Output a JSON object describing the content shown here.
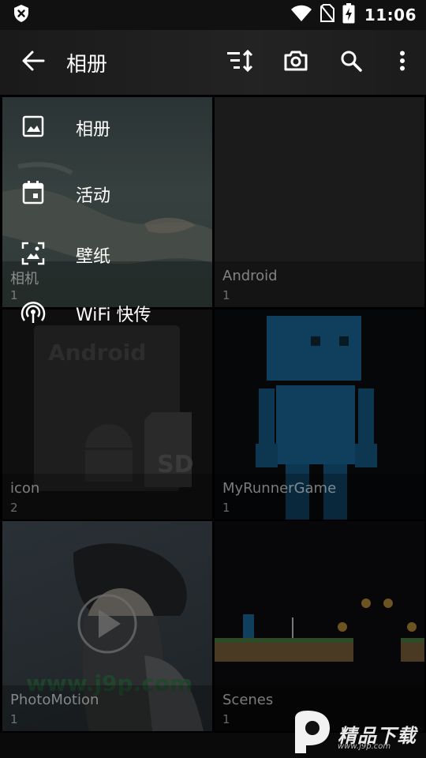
{
  "status_bar": {
    "time": "11:06",
    "icons": [
      "shield-x-icon",
      "wifi-icon",
      "no-sim-icon",
      "battery-charging-icon"
    ]
  },
  "app_bar": {
    "title": "相册",
    "actions": [
      "sort-icon",
      "camera-icon",
      "search-icon",
      "more-vert-icon"
    ]
  },
  "menu": {
    "items": [
      {
        "label": "相册",
        "icon": "image-icon"
      },
      {
        "label": "活动",
        "icon": "calendar-icon"
      },
      {
        "label": "壁纸",
        "icon": "wallpaper-icon"
      },
      {
        "label": "WiFi 快传",
        "icon": "wifi-transfer-icon"
      }
    ]
  },
  "albums": [
    {
      "name": "相机",
      "count": "1"
    },
    {
      "name": "Android",
      "count": "1"
    },
    {
      "name": "icon",
      "count": "2"
    },
    {
      "name": "MyRunnerGame",
      "count": "1"
    },
    {
      "name": "PhotoMotion",
      "count": "1"
    },
    {
      "name": "Scenes",
      "count": "1"
    }
  ],
  "thumb_text": {
    "android_card": "Android",
    "sd_card": "SD",
    "photo_watermark": "www.j9p.com"
  },
  "watermark": {
    "text": "精品下载",
    "sub": "www.j9p.com"
  }
}
